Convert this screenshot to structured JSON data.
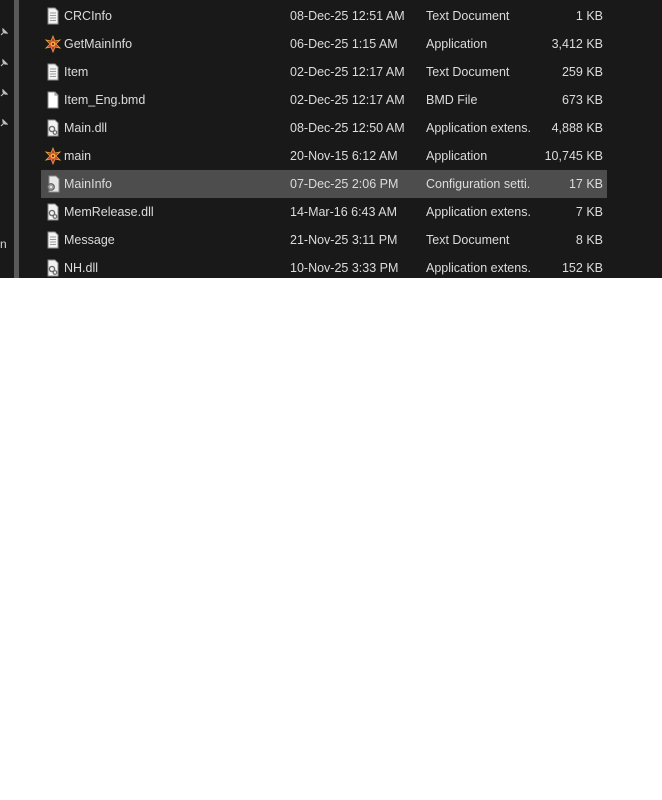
{
  "nav": {
    "partial_label": "n"
  },
  "files": [
    {
      "name": "CRCInfo",
      "date": "08-Dec-25 12:51 AM",
      "type": "Text Document",
      "size": "1 KB",
      "icon": "text-document-icon",
      "selected": false
    },
    {
      "name": "GetMainInfo",
      "date": "06-Dec-25 1:15 AM",
      "type": "Application",
      "size": "3,412 KB",
      "icon": "application-icon",
      "selected": false
    },
    {
      "name": "Item",
      "date": "02-Dec-25 12:17 AM",
      "type": "Text Document",
      "size": "259 KB",
      "icon": "text-document-icon",
      "selected": false
    },
    {
      "name": "Item_Eng.bmd",
      "date": "02-Dec-25 12:17 AM",
      "type": "BMD File",
      "size": "673 KB",
      "icon": "blank-file-icon",
      "selected": false
    },
    {
      "name": "Main.dll",
      "date": "08-Dec-25 12:50 AM",
      "type": "Application extens...",
      "size": "4,888 KB",
      "icon": "dll-file-icon",
      "selected": false
    },
    {
      "name": "main",
      "date": "20-Nov-15 6:12 AM",
      "type": "Application",
      "size": "10,745 KB",
      "icon": "application-icon",
      "selected": false
    },
    {
      "name": "MainInfo",
      "date": "07-Dec-25 2:06 PM",
      "type": "Configuration setti...",
      "size": "17 KB",
      "icon": "config-file-icon",
      "selected": true
    },
    {
      "name": "MemRelease.dll",
      "date": "14-Mar-16 6:43 AM",
      "type": "Application extens...",
      "size": "7 KB",
      "icon": "dll-file-icon",
      "selected": false
    },
    {
      "name": "Message",
      "date": "21-Nov-25 3:11 PM",
      "type": "Text Document",
      "size": "8 KB",
      "icon": "text-document-icon",
      "selected": false
    },
    {
      "name": "NH.dll",
      "date": "10-Nov-25 3:33 PM",
      "type": "Application extens...",
      "size": "152 KB",
      "icon": "dll-file-icon",
      "selected": false
    }
  ],
  "colors": {
    "background": "#191919",
    "selected_row": "#4d4d4d",
    "text": "#dcdcdc"
  }
}
